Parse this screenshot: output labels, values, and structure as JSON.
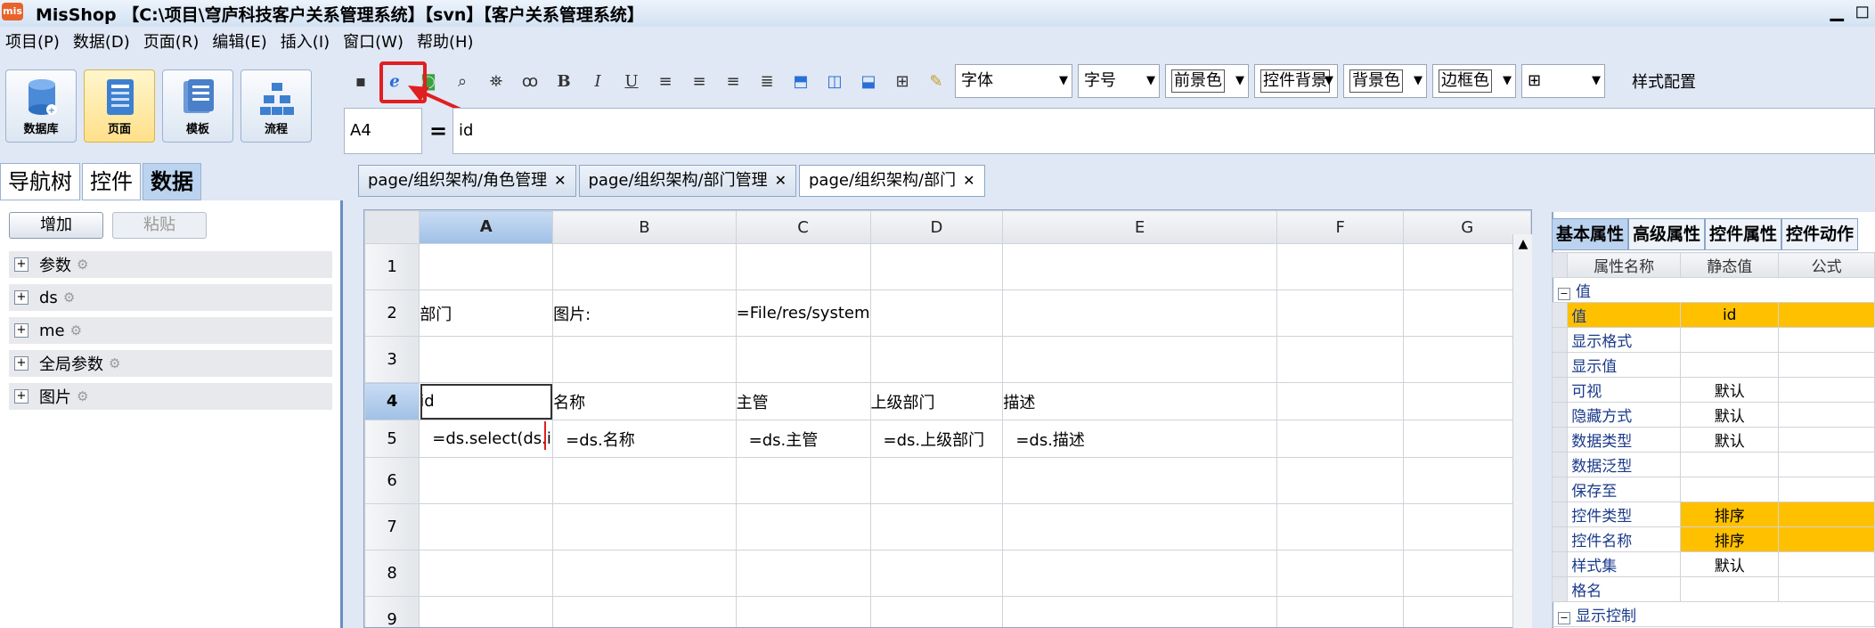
{
  "window": {
    "title": "MisShop 【C:\\项目\\穹庐科技客户关系管理系统】【svn】【客户关系管理系统】",
    "logo": "mis",
    "min": "▁",
    "max": "◻"
  },
  "menu": [
    "项目(P)",
    "数据(D)",
    "页面(R)",
    "编辑(E)",
    "插入(I)",
    "窗口(W)",
    "帮助(H)"
  ],
  "big_buttons": [
    {
      "label": "数据库",
      "icon": "database-icon"
    },
    {
      "label": "页面",
      "icon": "page-icon",
      "active": true
    },
    {
      "label": "模板",
      "icon": "template-icon"
    },
    {
      "label": "流程",
      "icon": "flow-icon"
    }
  ],
  "toolbar": {
    "font_label": "字体",
    "size_label": "字号",
    "fg_label": "前景色",
    "ctrl_bg_label": "控件背景",
    "bg_label": "背景色",
    "border_label": "边框色",
    "style_config": "样式配置"
  },
  "formula_bar": {
    "cell_ref": "A4",
    "eq": "=",
    "value": "id"
  },
  "left": {
    "tabs": [
      "导航树",
      "控件",
      "数据"
    ],
    "add": "增加",
    "paste": "粘贴",
    "tree": [
      "参数",
      "ds",
      "me",
      "全局参数",
      "图片"
    ]
  },
  "doc_tabs": [
    "page/组织架构/角色管理",
    "page/组织架构/部门管理",
    "page/组织架构/部门"
  ],
  "grid": {
    "cols": [
      "A",
      "B",
      "C",
      "D",
      "E",
      "F",
      "G"
    ],
    "rows": [
      "1",
      "2",
      "3",
      "4",
      "5",
      "6",
      "7",
      "8",
      "9"
    ],
    "cells": {
      "r2": [
        "部门",
        "图片:",
        "=File/res/system",
        "",
        "",
        "",
        ""
      ],
      "r4": [
        "id",
        "名称",
        "主管",
        "上级部门",
        "描述",
        "",
        ""
      ],
      "r5": [
        "=ds.select(ds.i",
        "=ds.名称",
        "=ds.主管",
        "=ds.上级部门",
        "=ds.描述",
        "",
        ""
      ]
    }
  },
  "right": {
    "tabs": [
      "基本属性",
      "高级属性",
      "控件属性",
      "控件动作"
    ],
    "headers": [
      "属性名称",
      "静态值",
      "公式"
    ],
    "group": "值",
    "props": [
      {
        "name": "值",
        "value": "id",
        "yellow": true
      },
      {
        "name": "显示格式",
        "value": ""
      },
      {
        "name": "显示值",
        "value": ""
      },
      {
        "name": "可视",
        "value": "默认"
      },
      {
        "name": "隐藏方式",
        "value": "默认"
      },
      {
        "name": "数据类型",
        "value": "默认"
      },
      {
        "name": "数据泛型",
        "value": ""
      },
      {
        "name": "保存至",
        "value": ""
      },
      {
        "name": "控件类型",
        "value": "排序",
        "yellow": true
      },
      {
        "name": "控件名称",
        "value": "排序",
        "yellow": true
      },
      {
        "name": "样式集",
        "value": "默认"
      },
      {
        "name": "格名",
        "value": ""
      }
    ],
    "group2": "显示控制"
  }
}
